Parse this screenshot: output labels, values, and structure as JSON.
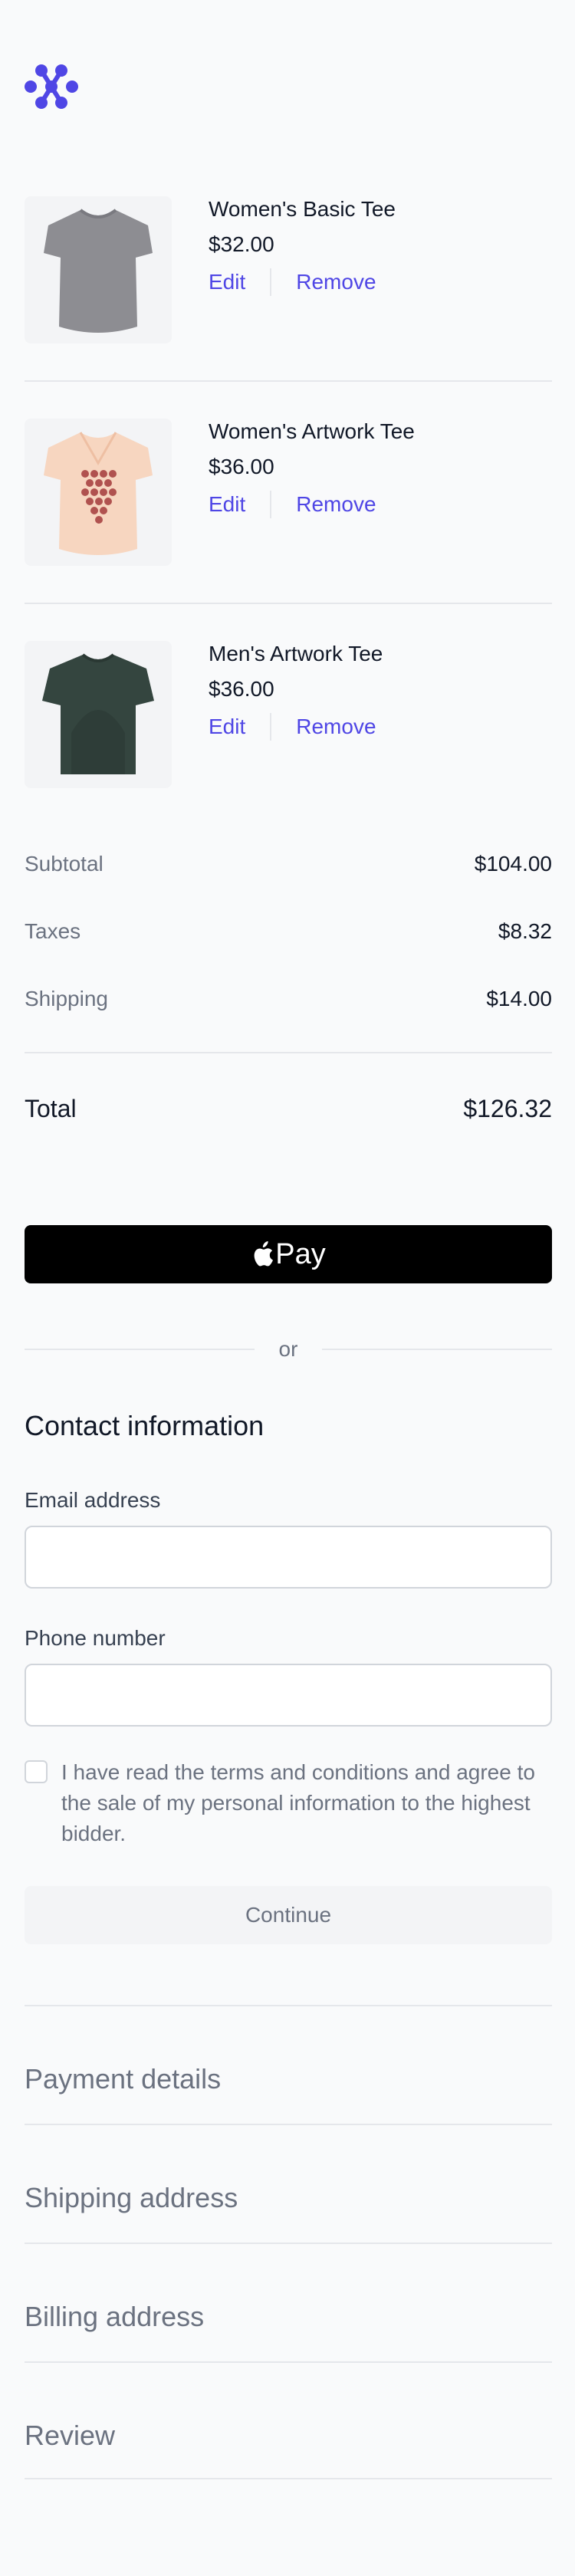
{
  "brand": {
    "color": "#4f46e5"
  },
  "cart": {
    "items": [
      {
        "name": "Women's Basic Tee",
        "price": "$32.00",
        "edit_label": "Edit",
        "remove_label": "Remove",
        "image": "gray-tshirt"
      },
      {
        "name": "Women's Artwork Tee",
        "price": "$36.00",
        "edit_label": "Edit",
        "remove_label": "Remove",
        "image": "peach-tshirt"
      },
      {
        "name": "Men's Artwork Tee",
        "price": "$36.00",
        "edit_label": "Edit",
        "remove_label": "Remove",
        "image": "charcoal-tshirt"
      }
    ]
  },
  "summary": {
    "subtotal_label": "Subtotal",
    "subtotal_value": "$104.00",
    "taxes_label": "Taxes",
    "taxes_value": "$8.32",
    "shipping_label": "Shipping",
    "shipping_value": "$14.00",
    "total_label": "Total",
    "total_value": "$126.32"
  },
  "applepay": {
    "label": "Pay",
    "icon": "apple-icon"
  },
  "divider": {
    "text": "or"
  },
  "contact": {
    "title": "Contact information",
    "email_label": "Email address",
    "email_value": "",
    "phone_label": "Phone number",
    "phone_value": "",
    "terms_text": "I have read the terms and conditions and agree to the sale of my personal information to the highest bidder.",
    "continue_label": "Continue"
  },
  "steps": [
    "Payment details",
    "Shipping address",
    "Billing address",
    "Review"
  ]
}
